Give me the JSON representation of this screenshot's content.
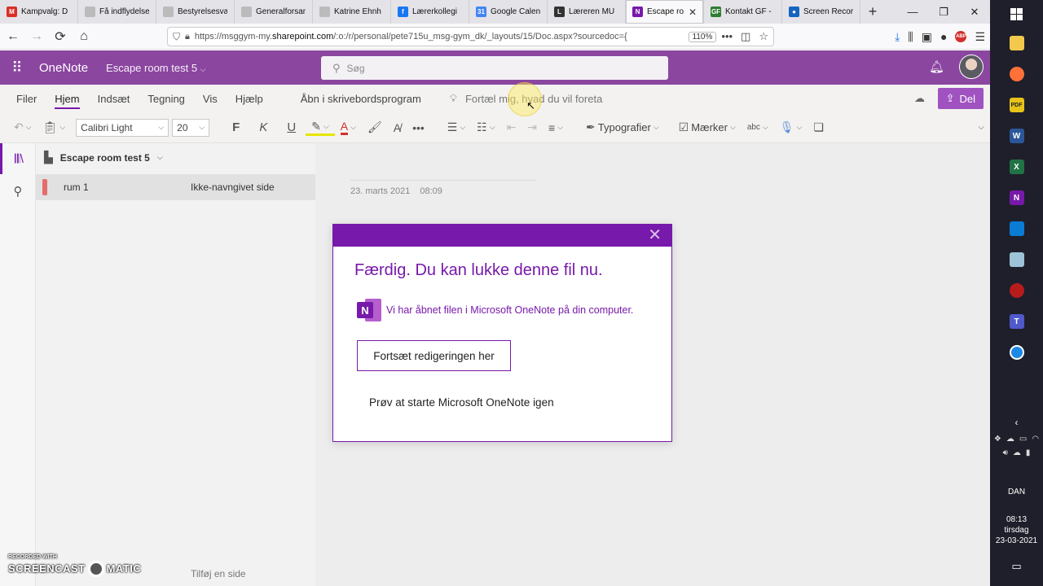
{
  "browser": {
    "tabs": [
      {
        "title": "Kampvalg: D",
        "favicon": "gmail-icon",
        "color": "#d93025",
        "glyph": "M",
        "active": false
      },
      {
        "title": "Få indflydelse",
        "favicon": "page-icon",
        "color": "#bbbbbb",
        "glyph": "",
        "active": false
      },
      {
        "title": "Bestyrelsesva",
        "favicon": "page-icon",
        "color": "#bbbbbb",
        "glyph": "",
        "active": false
      },
      {
        "title": "Generalforsamlin",
        "favicon": "page-icon",
        "color": "#bbbbbb",
        "glyph": "",
        "active": false
      },
      {
        "title": "Katrine Ehnh",
        "favicon": "page-icon",
        "color": "#bbbbbb",
        "glyph": "",
        "active": false
      },
      {
        "title": "Lærerkollegi",
        "favicon": "facebook-icon",
        "color": "#1877f2",
        "glyph": "f",
        "active": false
      },
      {
        "title": "Google Calen",
        "favicon": "calendar-icon",
        "color": "#4285f4",
        "glyph": "31",
        "active": false
      },
      {
        "title": "Læreren MU",
        "favicon": "l-icon",
        "color": "#333333",
        "glyph": "L",
        "active": false
      },
      {
        "title": "Escape ro",
        "favicon": "onenote-icon",
        "color": "#7719aa",
        "glyph": "N",
        "active": true
      },
      {
        "title": "Kontakt GF -",
        "favicon": "gf-icon",
        "color": "#2e7d32",
        "glyph": "GF",
        "active": false
      },
      {
        "title": "Screen Recor",
        "favicon": "screencast-icon",
        "color": "#1565c0",
        "glyph": "●",
        "active": false
      }
    ],
    "tab_close": "✕",
    "new_tab": "+",
    "url_prefix": "https://msggym-my.",
    "url_host": "sharepoint.com",
    "url_rest": "/:o:/r/personal/pete715u_msg-gym_dk/_layouts/15/Doc.aspx?sourcedoc={",
    "zoom": "110%"
  },
  "onenote": {
    "app_name": "OneNote",
    "notebook_title": "Escape room test 5",
    "search_placeholder": "Søg",
    "ribbon_tabs": [
      "Filer",
      "Hjem",
      "Indsæt",
      "Tegning",
      "Vis",
      "Hjælp",
      "Åbn i skrivebordsprogram"
    ],
    "selected_tab": "Hjem",
    "tell_me": "Fortæl mig, hvad du vil foreta",
    "share": "Del",
    "font_name": "Calibri Light",
    "font_size": "20",
    "bold": "F",
    "italic": "K",
    "underline": "U",
    "styles": "Typografier",
    "tags": "Mærker",
    "notebook_name": "Escape room test 5",
    "section": "rum 1",
    "page": "Ikke-navngivet side",
    "add_page": "Tilføj en side",
    "page_date": "23. marts 2021",
    "page_time": "08:09"
  },
  "dialog": {
    "title": "Færdig. Du kan lukke denne fil nu.",
    "message": "Vi har åbnet filen i Microsoft OneNote på din computer.",
    "continue_button": "Fortsæt redigeringen her",
    "retry_link": "Prøv at starte Microsoft OneNote igen",
    "close": "✕"
  },
  "taskbar": {
    "language": "DAN",
    "time": "08:13",
    "day": "tirsdag",
    "date": "23-03-2021"
  },
  "watermark": {
    "line1": "RECORDED WITH",
    "line2a": "SCREENCAST",
    "line2b": "MATIC"
  }
}
